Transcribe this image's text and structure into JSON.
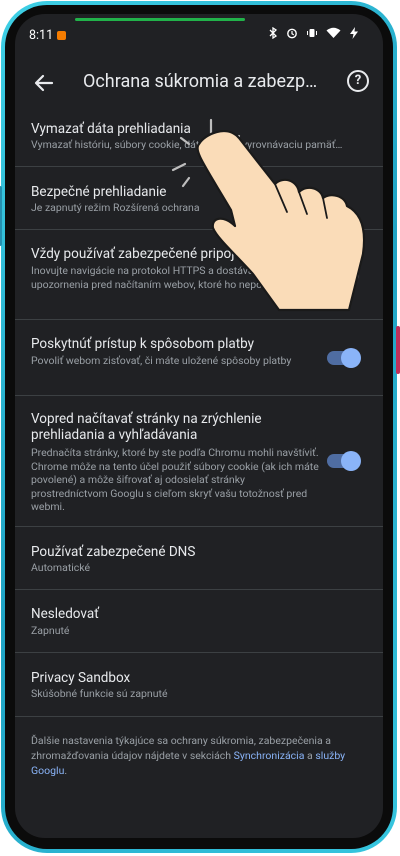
{
  "status_bar": {
    "time": "8:11",
    "icons": [
      "bluetooth-icon",
      "alarm-icon",
      "vibrate-icon",
      "wifi-icon",
      "charging-icon"
    ]
  },
  "app_bar": {
    "title": "Ochrana súkromia a zabezpečenia",
    "back_icon": "arrow-back-icon",
    "help_icon": "help-icon",
    "help_glyph": "?"
  },
  "items": [
    {
      "title": "Vymazať dáta prehliadania",
      "subtitle": "Vymazať históriu, súbory cookie, dáta webov, vyrovnávaciu pamäť…"
    },
    {
      "title": "Bezpečné prehliadanie",
      "subtitle": "Je zapnutý režim Rozšírená ochrana"
    },
    {
      "title": "Vždy používať zabezpečené pripojenia",
      "subtitle": "Inovujte navigácie na protokol HTTPS a dostávajte upozornenia pred načítaním webov, ktoré ho nepodporujú",
      "toggle": false
    },
    {
      "title": "Poskytnúť prístup k spôsobom platby",
      "subtitle": "Povoliť webom zisťovať, či máte uložené spôsoby platby",
      "toggle": true
    },
    {
      "title": "Vopred načítavať stránky na zrýchlenie prehliadania a vyhľadávania",
      "subtitle": "Prednačíta stránky, ktoré by ste podľa Chromu mohli navštíviť. Chrome môže na tento účel použiť súbory cookie (ak ich máte povolené) a môže šifrovať aj odosielať stránky prostredníctvom Googlu s cieľom skryť vašu totožnosť pred webmi.",
      "toggle": true
    },
    {
      "title": "Používať zabezpečené DNS",
      "subtitle": "Automatické"
    },
    {
      "title": "Nesledovať",
      "subtitle": "Zapnuté"
    },
    {
      "title": "Privacy Sandbox",
      "subtitle": "Skúšobné funkcie sú zapnuté"
    }
  ],
  "footer": {
    "text": "Ďalšie nastavenia týkajúce sa ochrany súkromia, zabezpečenia a zhromažďovania údajov nájdete v sekciách ",
    "link1": "Synchronizácia",
    "and": " a ",
    "link2": "služby Googlu",
    "end": "."
  },
  "overlay": {
    "icon": "tap-hand-icon"
  },
  "colors": {
    "background": "#202124",
    "toggle_on": "#8ab4f8",
    "accent_link": "#8ab4f8",
    "frame": "#1fa3c4"
  }
}
